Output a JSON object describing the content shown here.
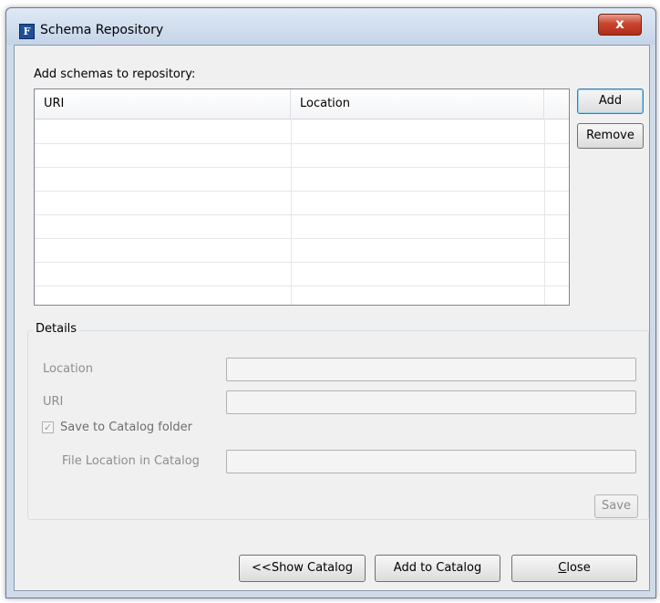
{
  "window": {
    "title": "Schema Repository",
    "close_glyph": "x",
    "app_icon_letter": "F"
  },
  "main": {
    "heading": "Add schemas to repository:",
    "table": {
      "columns": [
        "URI",
        "Location"
      ],
      "rows": [
        [
          "",
          ""
        ],
        [
          "",
          ""
        ],
        [
          "",
          ""
        ],
        [
          "",
          ""
        ],
        [
          "",
          ""
        ],
        [
          "",
          ""
        ],
        [
          "",
          ""
        ]
      ]
    },
    "add_label": "Add",
    "remove_label": "Remove"
  },
  "details": {
    "title": "Details",
    "location_label": "Location",
    "location_value": "",
    "uri_label": "URI",
    "uri_value": "",
    "save_to_catalog_label": "Save to Catalog folder",
    "save_to_catalog_checked": true,
    "file_location_label": "File Location in Catalog",
    "file_location_value": "",
    "save_label": "Save"
  },
  "footer": {
    "show_catalog_label": "<<Show Catalog",
    "add_to_catalog_label": "Add to Catalog",
    "close_label_rest": "lose",
    "close_mnemonic": "C"
  },
  "colors": {
    "titlebar": "#c4d4e7",
    "client": "#f0f0f0",
    "close_button": "#c8452f"
  }
}
